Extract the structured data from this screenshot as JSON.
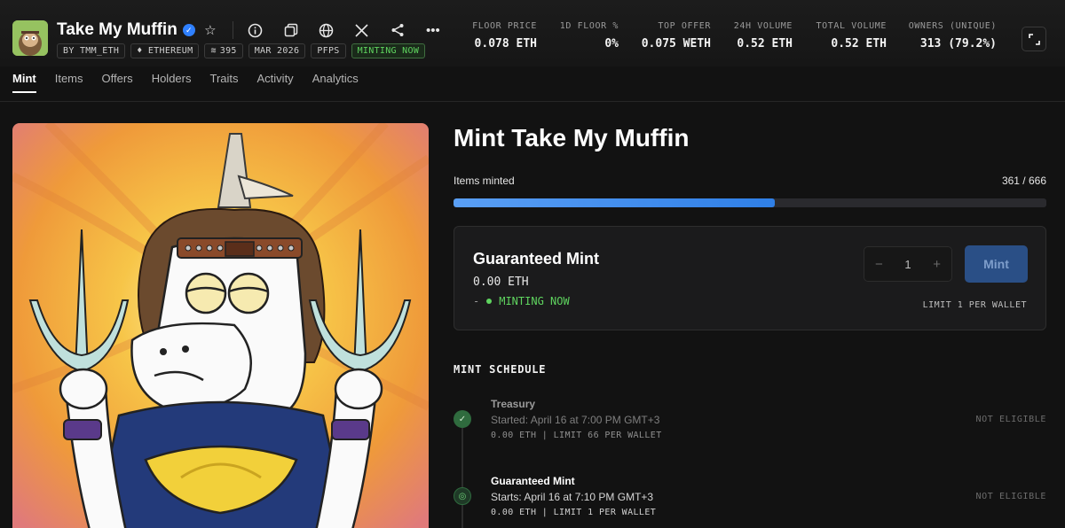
{
  "collection": {
    "name": "Take My Muffin",
    "tags": [
      "BY TMM_ETH",
      "♦ ETHEREUM",
      "395",
      "MAR 2026",
      "PFPS",
      "MINTING NOW"
    ]
  },
  "stats": [
    {
      "label": "FLOOR PRICE",
      "value": "0.078 ETH"
    },
    {
      "label": "1D FLOOR %",
      "value": "0%"
    },
    {
      "label": "TOP OFFER",
      "value": "0.075 WETH"
    },
    {
      "label": "24H VOLUME",
      "value": "0.52 ETH"
    },
    {
      "label": "TOTAL VOLUME",
      "value": "0.52 ETH"
    },
    {
      "label": "OWNERS (UNIQUE)",
      "value": "313 (79.2%)"
    }
  ],
  "tabs": [
    "Mint",
    "Items",
    "Offers",
    "Holders",
    "Traits",
    "Activity",
    "Analytics"
  ],
  "mint": {
    "title": "Mint Take My Muffin",
    "items_minted_label": "Items minted",
    "minted_count": "361 / 666",
    "progress_fraction": 0.542,
    "card": {
      "title": "Guaranteed Mint",
      "price": "0.00 ETH",
      "dash": "-",
      "status": "MINTING NOW",
      "quantity": "1",
      "minus": "−",
      "plus": "+",
      "mint_label": "Mint",
      "limit": "LIMIT 1 PER WALLET"
    },
    "schedule_title": "MINT SCHEDULE",
    "phases": [
      {
        "name": "Treasury",
        "time": "Started: April 16 at 7:00 PM GMT+3",
        "info": "0.00 ETH | LIMIT 66 PER WALLET",
        "eligibility": "NOT ELIGIBLE"
      },
      {
        "name": "Guaranteed Mint",
        "time": "Starts: April 16 at 7:10 PM GMT+3",
        "info": "0.00 ETH | LIMIT 1 PER WALLET",
        "eligibility": "NOT ELIGIBLE"
      }
    ]
  },
  "colors": {
    "accent": "#2f80ff",
    "live": "#5fd45f",
    "mint_button": "#2a4f86"
  },
  "icons": [
    "verified-icon",
    "star-icon",
    "info-icon",
    "copy-icon",
    "globe-icon",
    "x-icon",
    "share-icon",
    "more-icon",
    "expand-icon",
    "ethereum-icon",
    "layers-icon",
    "check-icon",
    "mint-phase-icon"
  ]
}
